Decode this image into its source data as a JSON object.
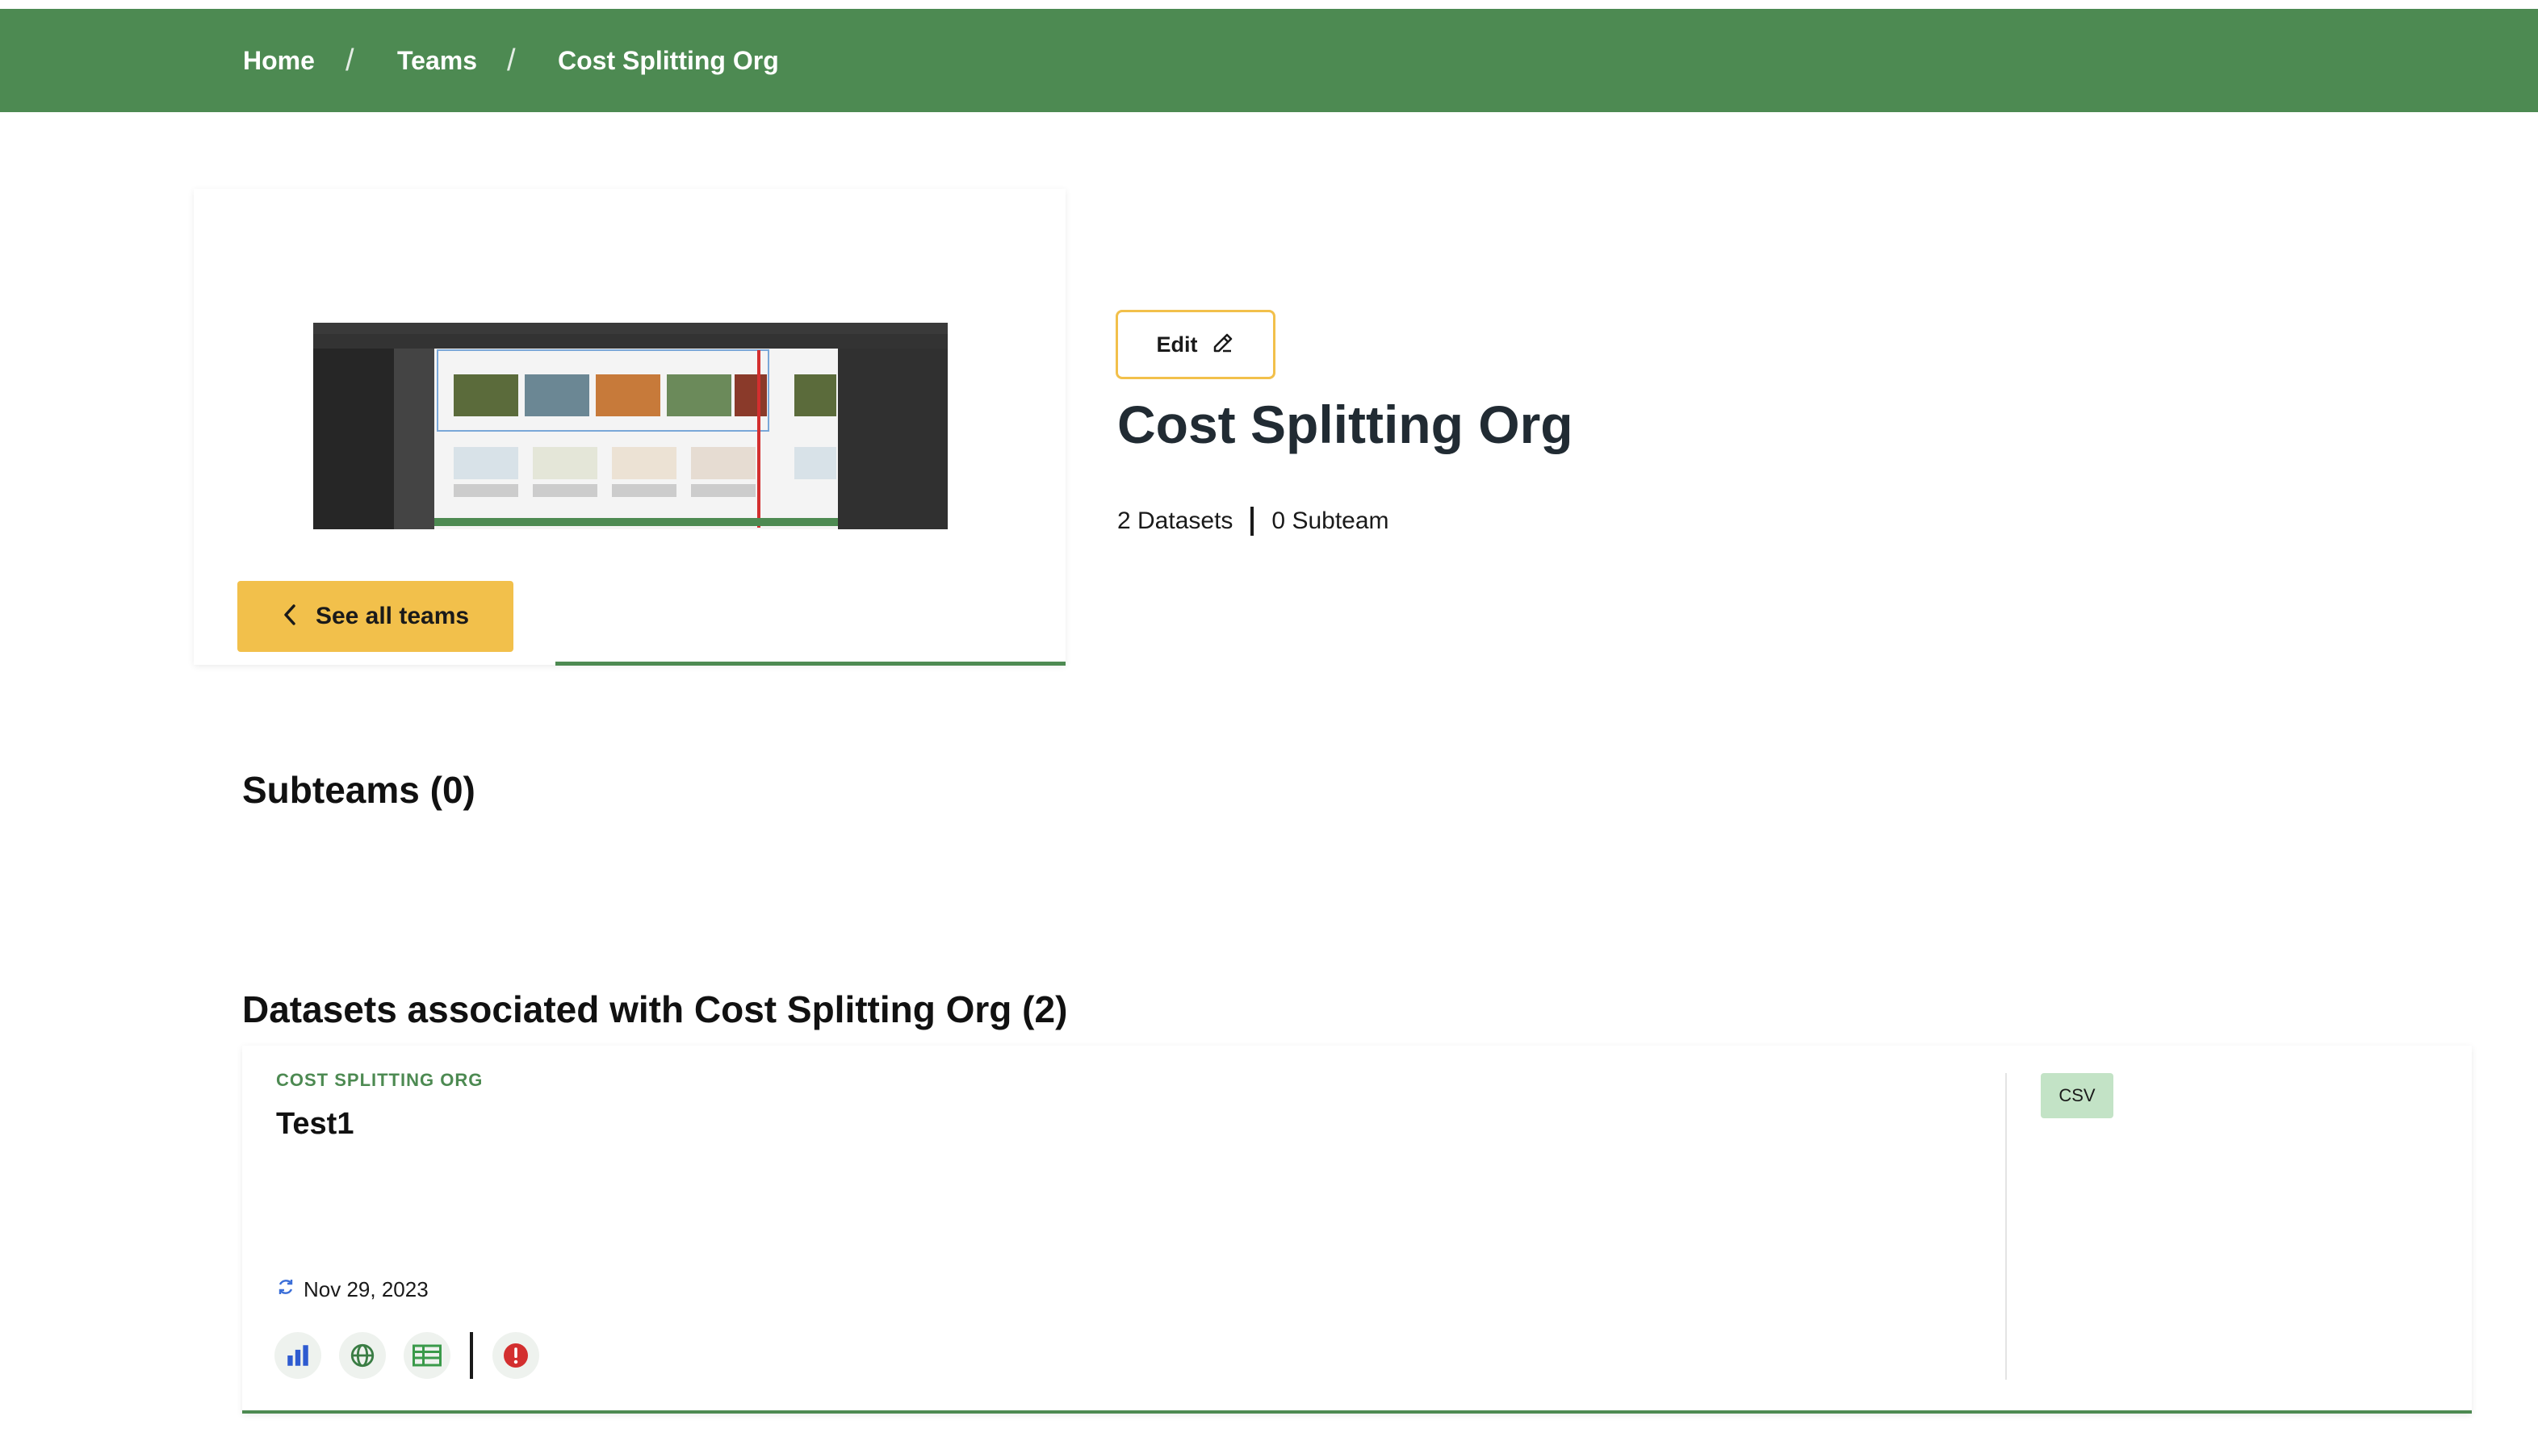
{
  "breadcrumb": {
    "items": [
      "Home",
      "Teams",
      "Cost Splitting Org"
    ],
    "separator": "/"
  },
  "team": {
    "title": "Cost Splitting Org",
    "edit_label": "Edit",
    "see_all_label": "See all teams",
    "datasets_count": "2 Datasets",
    "subteam_count": "0 Subteam"
  },
  "subteams": {
    "heading": "Subteams (0)"
  },
  "datasets": {
    "heading": "Datasets associated with Cost Splitting Org (2)",
    "items": [
      {
        "org": "COST SPLITTING ORG",
        "title": "Test1",
        "updated": "Nov 29, 2023",
        "format_badge": "CSV",
        "icons": [
          "bar-chart-icon",
          "globe-icon",
          "table-icon",
          "alert-icon"
        ]
      }
    ]
  },
  "colors": {
    "nav_green": "#4d8a52",
    "accent_yellow": "#f2c04b",
    "badge_green": "#c3e3c6"
  }
}
